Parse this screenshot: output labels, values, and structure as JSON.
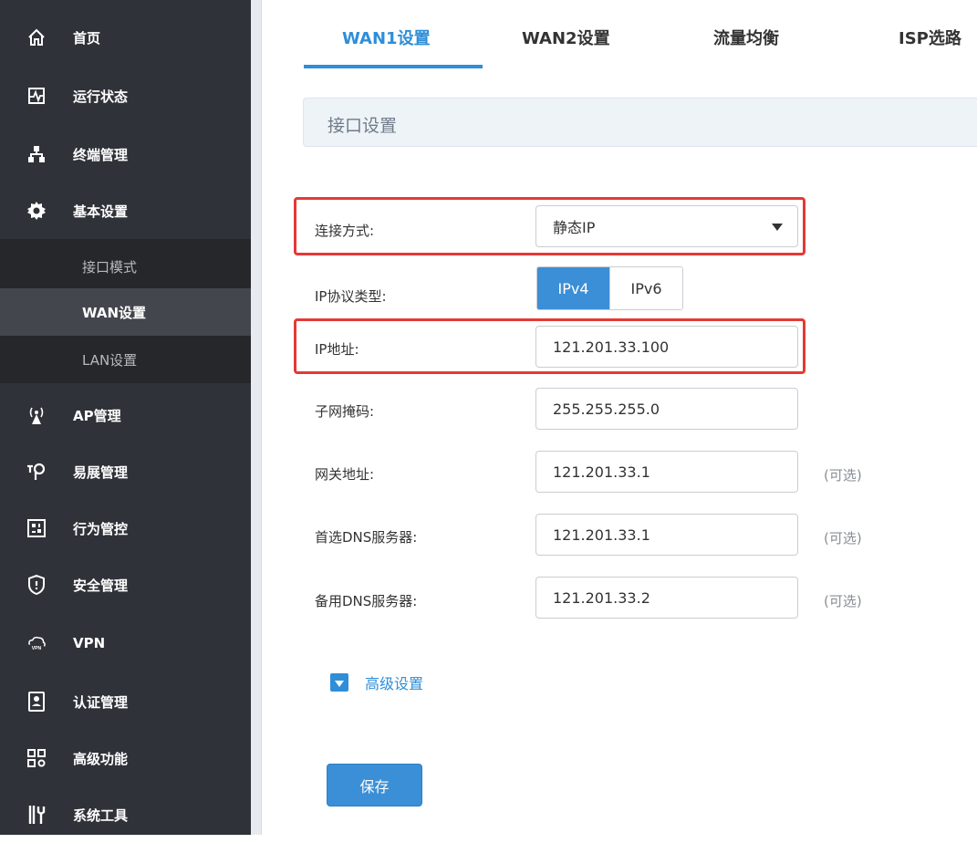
{
  "sidebar": {
    "items": [
      {
        "label": "首页",
        "icon": "home-icon"
      },
      {
        "label": "运行状态",
        "icon": "status-monitor-icon"
      },
      {
        "label": "终端管理",
        "icon": "network-tree-icon"
      },
      {
        "label": "基本设置",
        "icon": "gear-icon"
      },
      {
        "label": "AP管理",
        "icon": "wireless-ap-icon"
      },
      {
        "label": "易展管理",
        "icon": "easy-mesh-icon"
      },
      {
        "label": "行为管控",
        "icon": "behavior-control-icon"
      },
      {
        "label": "安全管理",
        "icon": "shield-icon"
      },
      {
        "label": "VPN",
        "icon": "vpn-cloud-icon"
      },
      {
        "label": "认证管理",
        "icon": "auth-badge-icon"
      },
      {
        "label": "高级功能",
        "icon": "advanced-grid-icon"
      },
      {
        "label": "系统工具",
        "icon": "tools-icon"
      }
    ],
    "sub_items": [
      {
        "label": "接口模式"
      },
      {
        "label": "WAN设置"
      },
      {
        "label": "LAN设置"
      }
    ]
  },
  "tabs": [
    {
      "label": "WAN1设置"
    },
    {
      "label": "WAN2设置"
    },
    {
      "label": "流量均衡"
    },
    {
      "label": "ISP选路"
    }
  ],
  "section": {
    "title": "接口设置"
  },
  "form": {
    "connection_type": {
      "label": "连接方式:",
      "value": "静态IP"
    },
    "ip_protocol": {
      "label": "IP协议类型:",
      "options": [
        "IPv4",
        "IPv6"
      ],
      "selected": "IPv4"
    },
    "ip_address": {
      "label": "IP地址:",
      "value": "121.201.33.100"
    },
    "subnet_mask": {
      "label": "子网掩码:",
      "value": "255.255.255.0"
    },
    "gateway": {
      "label": "网关地址:",
      "value": "121.201.33.1",
      "hint": "(可选)"
    },
    "primary_dns": {
      "label": "首选DNS服务器:",
      "value": "121.201.33.1",
      "hint": "(可选)"
    },
    "secondary_dns": {
      "label": "备用DNS服务器:",
      "value": "121.201.33.2",
      "hint": "(可选)"
    }
  },
  "advanced": {
    "label": "高级设置"
  },
  "save_label": "保存",
  "colors": {
    "accent": "#2f8ed8",
    "sidebar_bg": "#2f3238",
    "highlight": "#e53935"
  }
}
